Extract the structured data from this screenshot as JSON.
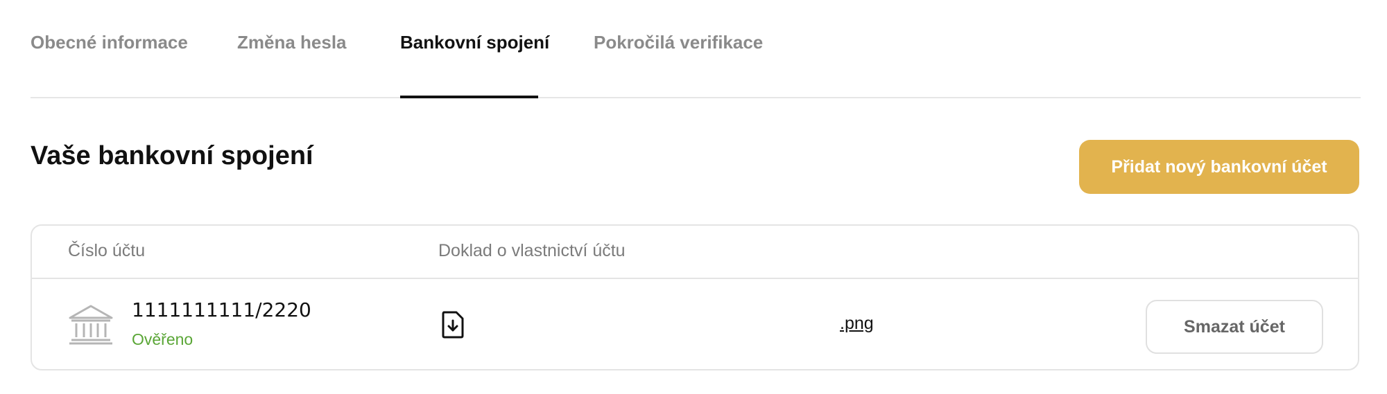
{
  "tabs": [
    {
      "label": "Obecné informace",
      "active": false
    },
    {
      "label": "Změna hesla",
      "active": false
    },
    {
      "label": "Bankovní spojení",
      "active": true
    },
    {
      "label": "Pokročilá verifikace",
      "active": false
    }
  ],
  "section": {
    "title": "Vaše bankovní spojení",
    "add_button_label": "Přidat nový bankovní účet"
  },
  "table": {
    "headers": [
      "Číslo účtu",
      "Doklad o vlastnictví účtu"
    ],
    "rows": [
      {
        "account_number": "1111111111/2220",
        "status": "Ověřeno",
        "document_name": ".png",
        "delete_label": "Smazat účet"
      }
    ]
  },
  "icons": {
    "bank": "bank-icon",
    "file_download": "file-download-icon"
  },
  "colors": {
    "accent": "#e2b34e",
    "verified": "#5aa636",
    "active_tab": "#111111",
    "inactive_tab": "#8a8a8a"
  }
}
